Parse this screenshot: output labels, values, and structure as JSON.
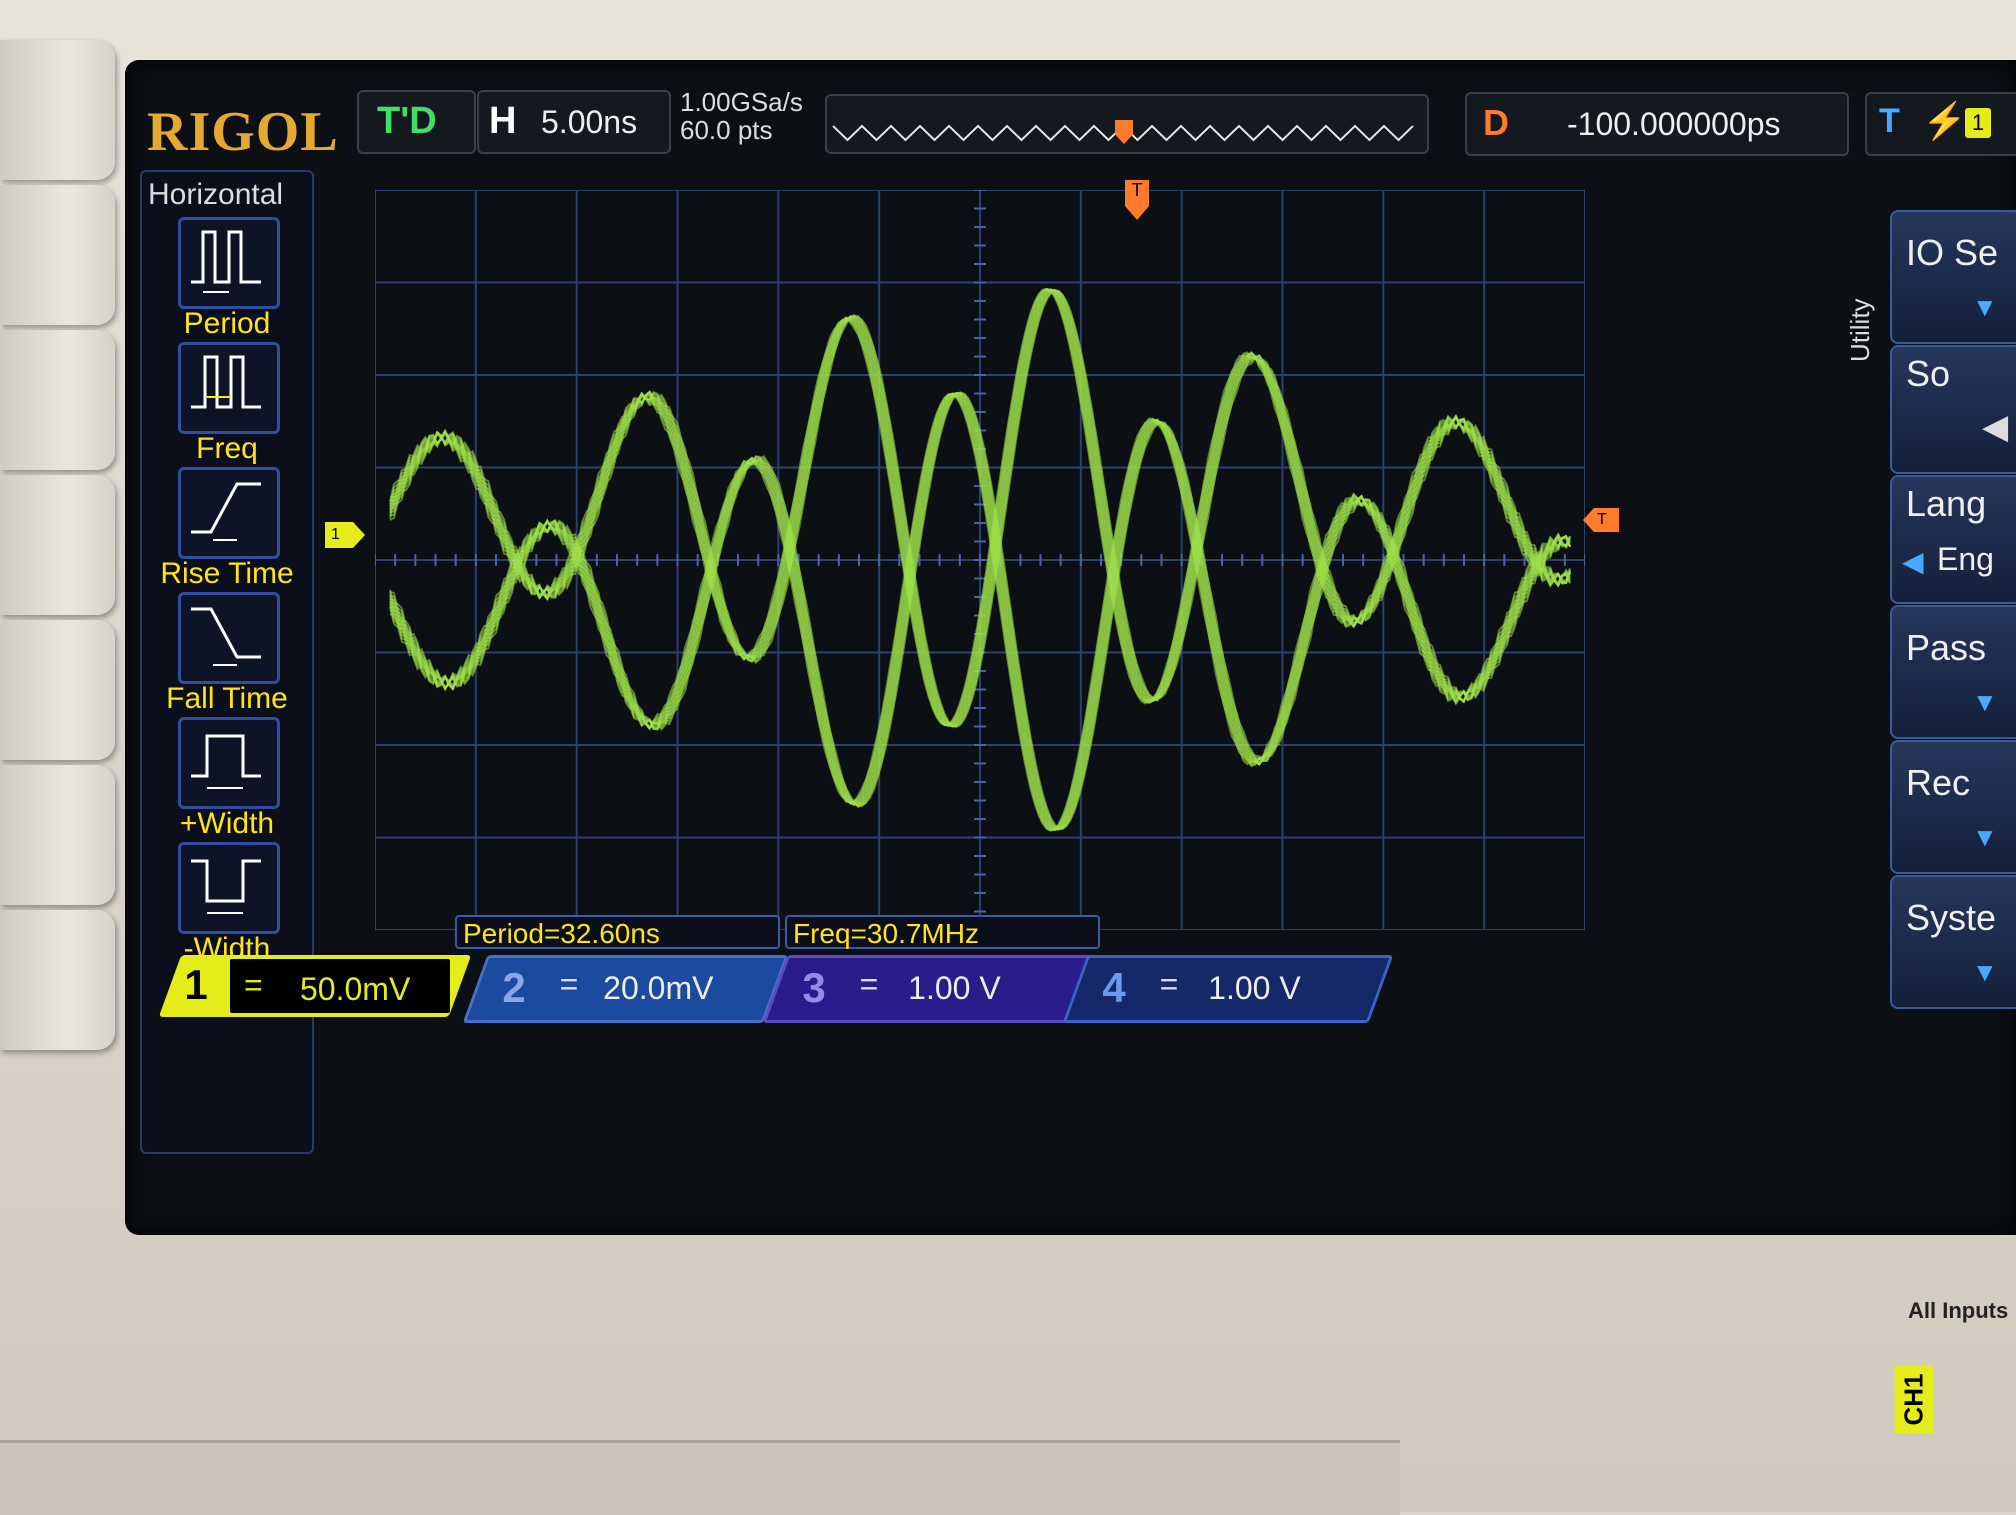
{
  "header": {
    "brand": "RIGOL",
    "run_status": "T'D",
    "timebase_label": "H",
    "timebase_value": "5.00ns",
    "sample_rate": "1.00GSa/s",
    "memory_depth": "60.0  pts",
    "delay_label": "D",
    "delay_value": "-100.000000ps",
    "trigger_label": "T",
    "trigger_source": "1"
  },
  "measure_menu": {
    "title": "Horizontal",
    "items": [
      {
        "label": "Period"
      },
      {
        "label": "Freq"
      },
      {
        "label": "Rise Time"
      },
      {
        "label": "Fall Time"
      },
      {
        "label": "+Width"
      },
      {
        "label": "-Width"
      }
    ]
  },
  "readouts": {
    "period": "Period=32.60ns",
    "freq": "Freq=30.7MHz"
  },
  "channels": [
    {
      "num": "1",
      "coupling": "=",
      "scale": "50.0mV",
      "color": "#e4ec1a"
    },
    {
      "num": "2",
      "coupling": "=",
      "scale": "20.0mV",
      "color": "#4a6ec8"
    },
    {
      "num": "3",
      "coupling": "=",
      "scale": "1.00 V",
      "color": "#5a4ac8"
    },
    {
      "num": "4",
      "coupling": "=",
      "scale": "1.00 V",
      "color": "#3a62c8"
    }
  ],
  "right_menu": {
    "section": "Utility",
    "items": [
      "IO Se",
      "So",
      "Lang",
      "Eng",
      "Pass",
      "Rec",
      "Syste"
    ]
  },
  "markers": {
    "ch1_level": "1",
    "trigger_level": "T",
    "trigger_time": "T"
  },
  "bezel": {
    "all_inputs": "All Inputs",
    "ch1_input": "CH1"
  },
  "colors": {
    "trace": "#9fe04a",
    "brand": "#e7a832",
    "trigger": "#ff7a2a",
    "ch1": "#e4ec1a"
  }
}
